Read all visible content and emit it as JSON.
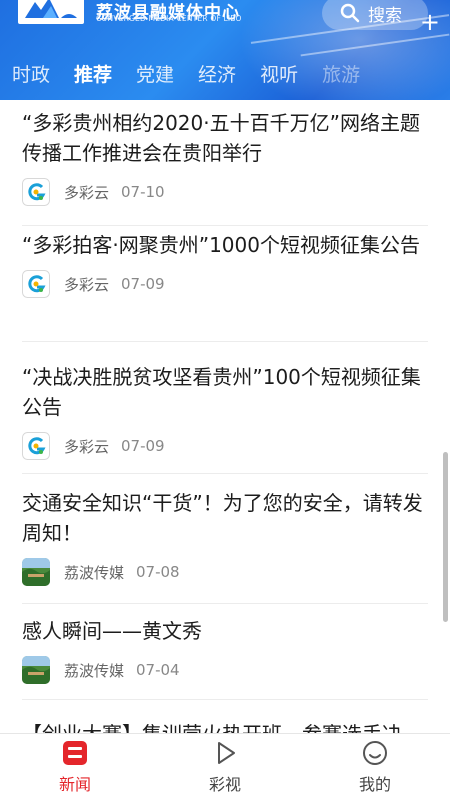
{
  "header": {
    "brand_cn": "荔波县融媒体中心",
    "brand_en": "CONVERGED MEDIA CENTER OF LIBO",
    "search_label": "搜索",
    "accent_color": "#2a7ee8"
  },
  "tabs": [
    {
      "label": "时政"
    },
    {
      "label": "推荐",
      "active": true
    },
    {
      "label": "党建"
    },
    {
      "label": "经济"
    },
    {
      "label": "视听"
    },
    {
      "label": "旅游"
    }
  ],
  "tab_add": "+",
  "news": [
    {
      "title": "“多彩贵州相约2020·五十百千万亿”网络主题传播工作推进会在贵阳举行",
      "source": "多彩云",
      "date": "07-10",
      "icon": "duocaiyun-logo-icon"
    },
    {
      "title": "“多彩拍客·网聚贵州”1000个短视频征集公告",
      "source": "多彩云",
      "date": "07-09",
      "icon": "duocaiyun-logo-icon"
    },
    {
      "title": "“决战决胜脱贫攻坚看贵州”100个短视频征集公告",
      "source": "多彩云",
      "date": "07-09",
      "icon": "duocaiyun-logo-icon"
    },
    {
      "title": "交通安全知识“干货”！为了您的安全，请转发周知！",
      "source": "荔波传媒",
      "date": "07-08",
      "icon": "libo-media-icon"
    },
    {
      "title": "感人瞬间——黄文秀",
      "source": "荔波传媒",
      "date": "07-04",
      "icon": "libo-media-icon"
    }
  ],
  "partial_title": "【创业大赛】集训营火热开班，参赛选手决",
  "bottom_nav": [
    {
      "label": "新闻",
      "icon": "news-icon",
      "active": true,
      "color": "#e4262b"
    },
    {
      "label": "彩视",
      "icon": "play-icon"
    },
    {
      "label": "我的",
      "icon": "profile-smile-icon"
    }
  ]
}
